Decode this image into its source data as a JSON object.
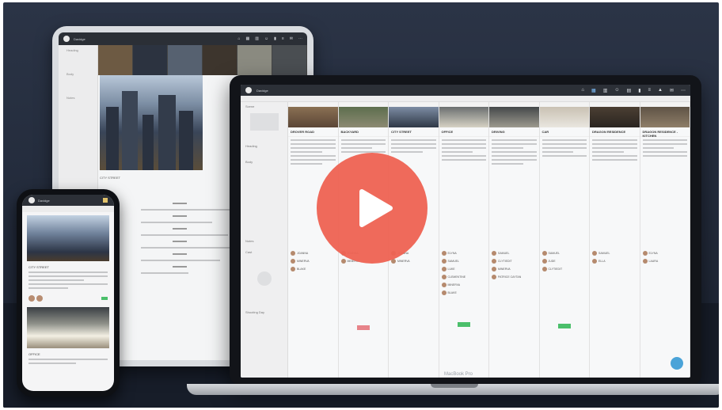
{
  "colors": {
    "background": "#232b3b",
    "play_button": "#ee6252",
    "topbar": "#2c3037",
    "accent": "#7ec1ff",
    "green_marker": "#4bbf6b",
    "red_marker": "#e7848a"
  },
  "laptop": {
    "brand_label": "MacBook Pro",
    "app_name": "Davidge",
    "toolbar_icons": [
      "home-icon",
      "board-icon",
      "columns-icon",
      "cast-icon",
      "calendar-icon",
      "chart-icon",
      "list-icon",
      "school-icon",
      "chat-icon",
      "more-icon"
    ],
    "sidebar_labels": [
      "Scene",
      "Heading",
      "Body",
      "Notes",
      "Cast",
      "Shooting Day"
    ],
    "scenes": [
      {
        "title": "DROVER ROAD",
        "cast": [
          "JOANNA",
          "MINERVA",
          "BLAKE"
        ]
      },
      {
        "title": "BACKYARD",
        "cast": [
          "JOANNA",
          "MINERVA"
        ]
      },
      {
        "title": "CITY STREET",
        "cast": [
          "JOANNA",
          "MINERVA"
        ]
      },
      {
        "title": "OFFICE",
        "cast": [
          "ELYNA",
          "SAMUEL",
          "LUKE",
          "CLEMENTINE",
          "MINERVA",
          "BLAKE"
        ]
      },
      {
        "title": "DRIVING",
        "cast": [
          "SAMUEL",
          "CLYTIEDIT",
          "MINERVA",
          "PATRICE CAYTAN"
        ]
      },
      {
        "title": "CAR",
        "cast": [
          "SAMUEL",
          "JUDE",
          "CLYTIEDIT"
        ]
      },
      {
        "title": "DRAGON RESIDENCE",
        "cast": [
          "SAMUEL",
          "ELLA"
        ]
      },
      {
        "title": "DRAGON RESIDENCE - KITCHEN",
        "cast": [
          "ELYNA",
          "LAURA"
        ]
      }
    ]
  },
  "phone": {
    "app_name": "Davidge",
    "scene_heading": "CITY STREET",
    "second_heading": "OFFICE"
  },
  "tablet": {
    "app_name": "Davidge",
    "scene_heading": "CITY STREET",
    "sidebar_labels": [
      "Heading",
      "Body",
      "Notes"
    ]
  },
  "video": {
    "play_icon": "play-icon"
  }
}
